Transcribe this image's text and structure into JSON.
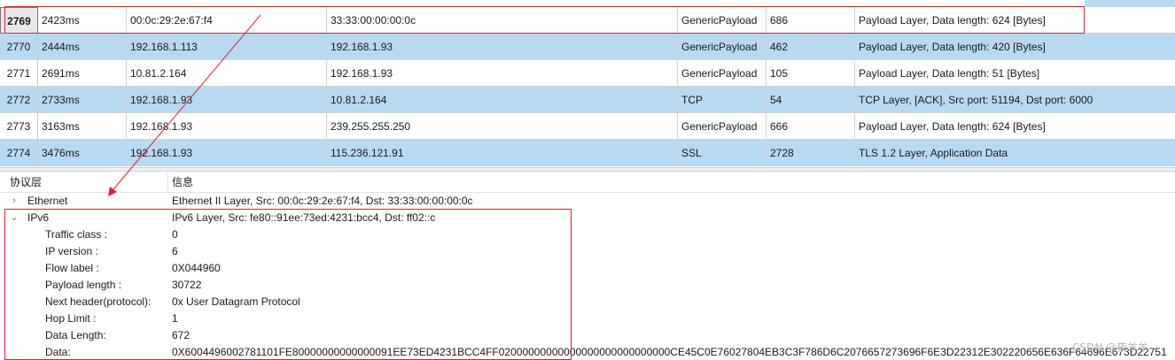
{
  "packets": [
    {
      "no": "2769",
      "time": "2423ms",
      "src": "00:0c:29:2e:67:f4",
      "dst": "33:33:00:00:00:0c",
      "proto": "GenericPayload",
      "len": "686",
      "info": "Payload Layer, Data length: 624 [Bytes]"
    },
    {
      "no": "2770",
      "time": "2444ms",
      "src": "192.168.1.113",
      "dst": "192.168.1.93",
      "proto": "GenericPayload",
      "len": "462",
      "info": "Payload Layer, Data length: 420 [Bytes]"
    },
    {
      "no": "2771",
      "time": "2691ms",
      "src": "10.81.2.164",
      "dst": "192.168.1.93",
      "proto": "GenericPayload",
      "len": "105",
      "info": "Payload Layer, Data length: 51 [Bytes]"
    },
    {
      "no": "2772",
      "time": "2733ms",
      "src": "192.168.1.93",
      "dst": "10.81.2.164",
      "proto": "TCP",
      "len": "54",
      "info": "TCP Layer, [ACK], Src port: 51194, Dst port: 6000"
    },
    {
      "no": "2773",
      "time": "3163ms",
      "src": "192.168.1.93",
      "dst": "239.255.255.250",
      "proto": "GenericPayload",
      "len": "666",
      "info": "Payload Layer, Data length: 624 [Bytes]"
    },
    {
      "no": "2774",
      "time": "3476ms",
      "src": "192.168.1.93",
      "dst": "115.236.121.91",
      "proto": "SSL",
      "len": "2728",
      "info": "TLS 1.2 Layer, Application Data"
    }
  ],
  "tree": {
    "header_layer": "协议层",
    "header_info": "信息",
    "ethernet": {
      "name": "Ethernet",
      "info": "Ethernet II Layer, Src: 00:0c:29:2e:67:f4, Dst: 33:33:00:00:00:0c"
    },
    "ipv6": {
      "name": "IPv6",
      "info": "IPv6 Layer, Src: fe80::91ee:73ed:4231:bcc4, Dst: ff02::c"
    },
    "fields": [
      {
        "name": "Traffic class :",
        "value": "0"
      },
      {
        "name": "IP version :",
        "value": "6"
      },
      {
        "name": "Flow label :",
        "value": "0X044960"
      },
      {
        "name": "Payload length :",
        "value": "30722"
      },
      {
        "name": "Next header(protocol):",
        "value": "0x User Datagram Protocol"
      },
      {
        "name": "Hop Limit :",
        "value": "1"
      },
      {
        "name": "Data Length:",
        "value": "672"
      },
      {
        "name": "Data:",
        "value": "0X6004496002781101FE80000000000000091EE73ED4231BCC4FF02000000000000000000000000000CE45C0E76027804EB3C3F786D6C2076657273696F6E3D22312E302220656E636F64696E673D22751"
      }
    ]
  },
  "icons": {
    "collapsed": "chevron-right-icon",
    "expanded": "chevron-down-icon"
  },
  "colors": {
    "row_alt": "#b8d9f2",
    "highlight": "#d9232d"
  },
  "watermark": "CSDN @夜羊羊"
}
